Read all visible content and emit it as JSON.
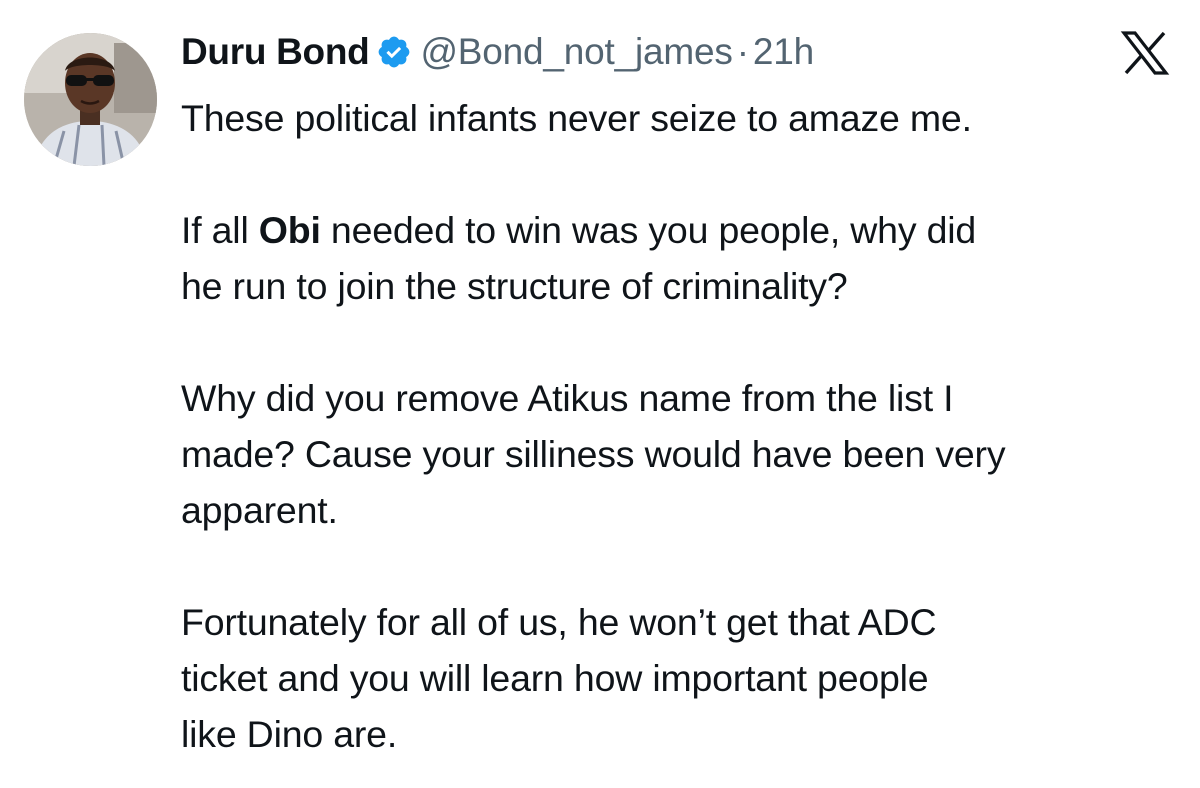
{
  "author": {
    "display_name": "Duru Bond",
    "handle": "@Bond_not_james",
    "separator": "·",
    "time_ago": "21h",
    "verified_icon": "verified-badge-icon",
    "verified_color": "#1d9bf0"
  },
  "platform": {
    "logo_icon": "x-logo-icon"
  },
  "tweet": {
    "p1": "These political infants never seize to amaze me.",
    "p2_pre": "If all ",
    "p2_bold": "Obi",
    "p2_line1_post": " needed to win was you people, why did",
    "p2_line2": "he run to join the structure of criminality?",
    "p3_line1": "Why did you remove Atikus name from the list I",
    "p3_line2": "made? Cause your silliness would have been very",
    "p3_line3": "apparent.",
    "p4_line1": "Fortunately for all of us, he won’t get that ADC",
    "p4_line2": "ticket and you will learn how important people",
    "p4_line3": "like Dino are."
  }
}
